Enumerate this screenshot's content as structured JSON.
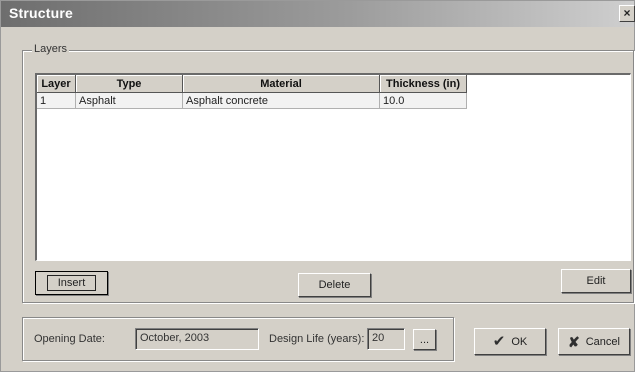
{
  "window": {
    "title": "Structure",
    "close_symbol": "×"
  },
  "layers_group": {
    "label": "Layers"
  },
  "grid": {
    "columns": [
      "Layer",
      "Type",
      "Material",
      "Thickness (in)"
    ],
    "rows": [
      {
        "layer": "1",
        "type": "Asphalt",
        "material": "Asphalt concrete",
        "thickness": "10.0"
      }
    ]
  },
  "buttons": {
    "insert": "Insert",
    "delete": "Delete",
    "edit": "Edit",
    "ok": "OK",
    "cancel": "Cancel",
    "browse": "..."
  },
  "bottom": {
    "opening_date_label": "Opening Date:",
    "opening_date_value": "October, 2003",
    "design_life_label": "Design Life (years):",
    "design_life_value": "20"
  },
  "icons": {
    "ok": "checkmark-icon",
    "cancel": "x-icon",
    "close": "close-icon"
  }
}
